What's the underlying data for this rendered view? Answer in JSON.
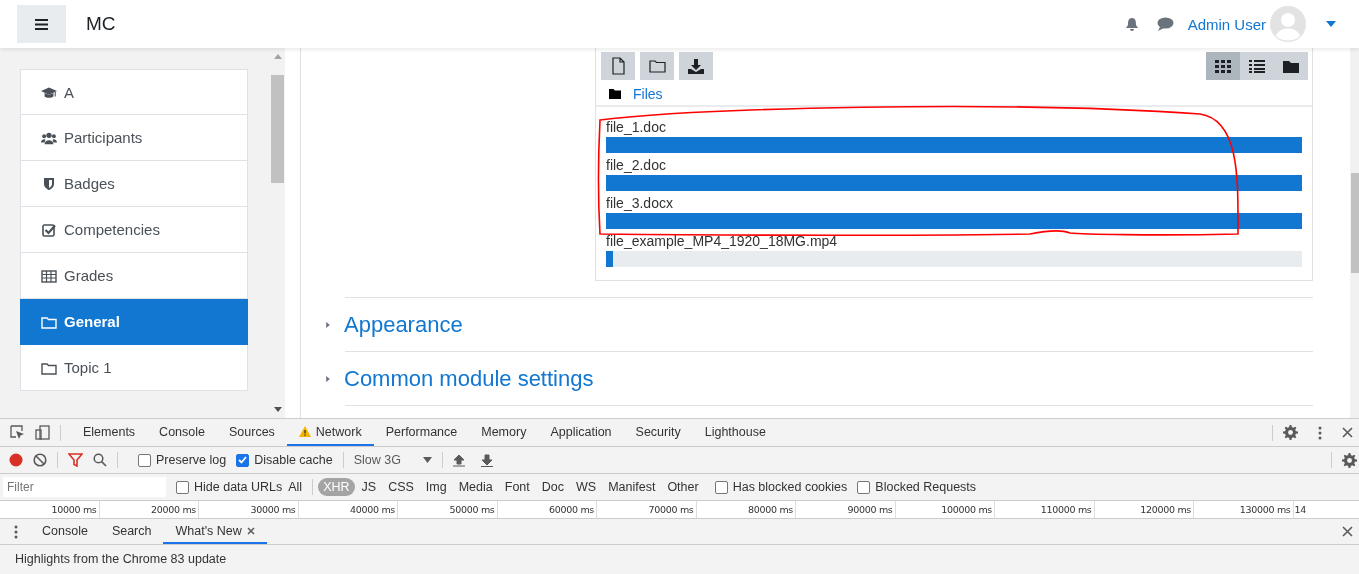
{
  "header": {
    "app_name": "MC",
    "user_name": "Admin User"
  },
  "sidebar": {
    "items": [
      {
        "label": "A",
        "kind": "cap",
        "selected": false
      },
      {
        "label": "Participants",
        "kind": "users",
        "selected": false
      },
      {
        "label": "Badges",
        "kind": "shield",
        "selected": false
      },
      {
        "label": "Competencies",
        "kind": "checkbox",
        "selected": false
      },
      {
        "label": "Grades",
        "kind": "table",
        "selected": false
      },
      {
        "label": "General",
        "kind": "folder",
        "selected": true
      },
      {
        "label": "Topic 1",
        "kind": "folder",
        "selected": false
      }
    ]
  },
  "file_manager": {
    "path": "Files",
    "view_modes": [
      {
        "kind": "grid",
        "selected": true
      },
      {
        "kind": "list",
        "selected": false
      },
      {
        "kind": "tree",
        "selected": false
      }
    ],
    "files": [
      {
        "name": "file_1.doc",
        "level": 1
      },
      {
        "name": "file_2.doc",
        "level": 1
      },
      {
        "name": "file_3.docx",
        "level": 1
      },
      {
        "name": "file_example_MP4_1920_18MG.mp4",
        "level": 0.01
      }
    ]
  },
  "sections": [
    {
      "title": "Appearance",
      "expanded": false
    },
    {
      "title": "Common module settings",
      "expanded": false
    }
  ],
  "devtools": {
    "tabs": [
      {
        "label": "Elements",
        "selected": false,
        "warning": false
      },
      {
        "label": "Console",
        "selected": false,
        "warning": false
      },
      {
        "label": "Sources",
        "selected": false,
        "warning": false
      },
      {
        "label": "Network",
        "selected": true,
        "warning": true
      },
      {
        "label": "Performance",
        "selected": false,
        "warning": false
      },
      {
        "label": "Memory",
        "selected": false,
        "warning": false
      },
      {
        "label": "Application",
        "selected": false,
        "warning": false
      },
      {
        "label": "Security",
        "selected": false,
        "warning": false
      },
      {
        "label": "Lighthouse",
        "selected": false,
        "warning": false
      }
    ],
    "toolbar": {
      "recording": true,
      "preserve_log": {
        "label": "Preserve log",
        "checked": false
      },
      "disable_cache": {
        "label": "Disable cache",
        "checked": true
      },
      "throttling": "Slow 3G"
    },
    "filter": {
      "placeholder": "Filter",
      "hide_data_urls": {
        "label": "Hide data URLs",
        "checked": false
      },
      "types": [
        {
          "label": "All",
          "selected": false
        },
        {
          "label": "XHR",
          "selected": true
        },
        {
          "label": "JS",
          "selected": false
        },
        {
          "label": "CSS",
          "selected": false
        },
        {
          "label": "Img",
          "selected": false
        },
        {
          "label": "Media",
          "selected": false
        },
        {
          "label": "Font",
          "selected": false
        },
        {
          "label": "Doc",
          "selected": false
        },
        {
          "label": "WS",
          "selected": false
        },
        {
          "label": "Manifest",
          "selected": false
        },
        {
          "label": "Other",
          "selected": false
        }
      ],
      "has_blocked_cookies": {
        "label": "Has blocked cookies",
        "checked": false
      },
      "blocked_requests": {
        "label": "Blocked Requests",
        "checked": false
      }
    },
    "timeline_ticks": [
      "10000 ms",
      "20000 ms",
      "30000 ms",
      "40000 ms",
      "50000 ms",
      "60000 ms",
      "70000 ms",
      "80000 ms",
      "90000 ms",
      "100000 ms",
      "110000 ms",
      "120000 ms",
      "130000 ms",
      "14"
    ],
    "drawer": {
      "tabs": [
        {
          "label": "Console",
          "selected": false,
          "closable": false
        },
        {
          "label": "Search",
          "selected": false,
          "closable": false
        },
        {
          "label": "What's New",
          "selected": true,
          "closable": true
        }
      ],
      "text": "Highlights from the Chrome 83 update"
    }
  }
}
